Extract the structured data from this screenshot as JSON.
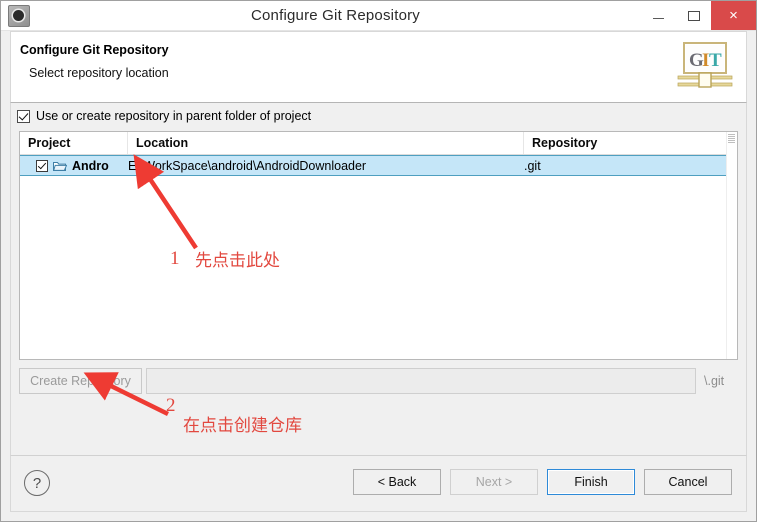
{
  "window": {
    "title": "Configure Git Repository",
    "icon": "eclipse-gear-icon",
    "minimize_label": "–",
    "maximize_label": "□",
    "close_label": "×"
  },
  "header": {
    "title": "Configure Git Repository",
    "subtitle": "Select repository location",
    "logo_text": "GIT",
    "logo_letters": [
      "G",
      "I",
      "T"
    ],
    "logo_colors": [
      "#6b6b73",
      "#d08a2a",
      "#3aa8a8"
    ]
  },
  "options": {
    "use_parent_folder_label": "Use or create repository in parent folder of project",
    "use_parent_folder_checked": true
  },
  "table": {
    "columns": [
      "Project",
      "Location",
      "Repository"
    ],
    "rows": [
      {
        "checked": true,
        "icon": "open-folder-icon",
        "project": "Andro",
        "location": "E:\\WorkSpace\\android\\AndroidDownloader",
        "repository": ".git",
        "selected": true
      }
    ]
  },
  "create_repository": {
    "button_label": "Create Repository",
    "button_enabled": false,
    "path_value": "",
    "path_placeholder": "",
    "suffix_label": "\\.git"
  },
  "footer": {
    "help_label": "?",
    "buttons": [
      {
        "label": "< Back",
        "state": "enabled"
      },
      {
        "label": "Next >",
        "state": "disabled"
      },
      {
        "label": "Finish",
        "state": "default"
      },
      {
        "label": "Cancel",
        "state": "enabled"
      }
    ]
  },
  "annotations": {
    "color": "#e2483f",
    "items": [
      {
        "number": "1",
        "text": "先点击此处"
      },
      {
        "number": "2",
        "text": "在点击创建仓库"
      }
    ]
  }
}
